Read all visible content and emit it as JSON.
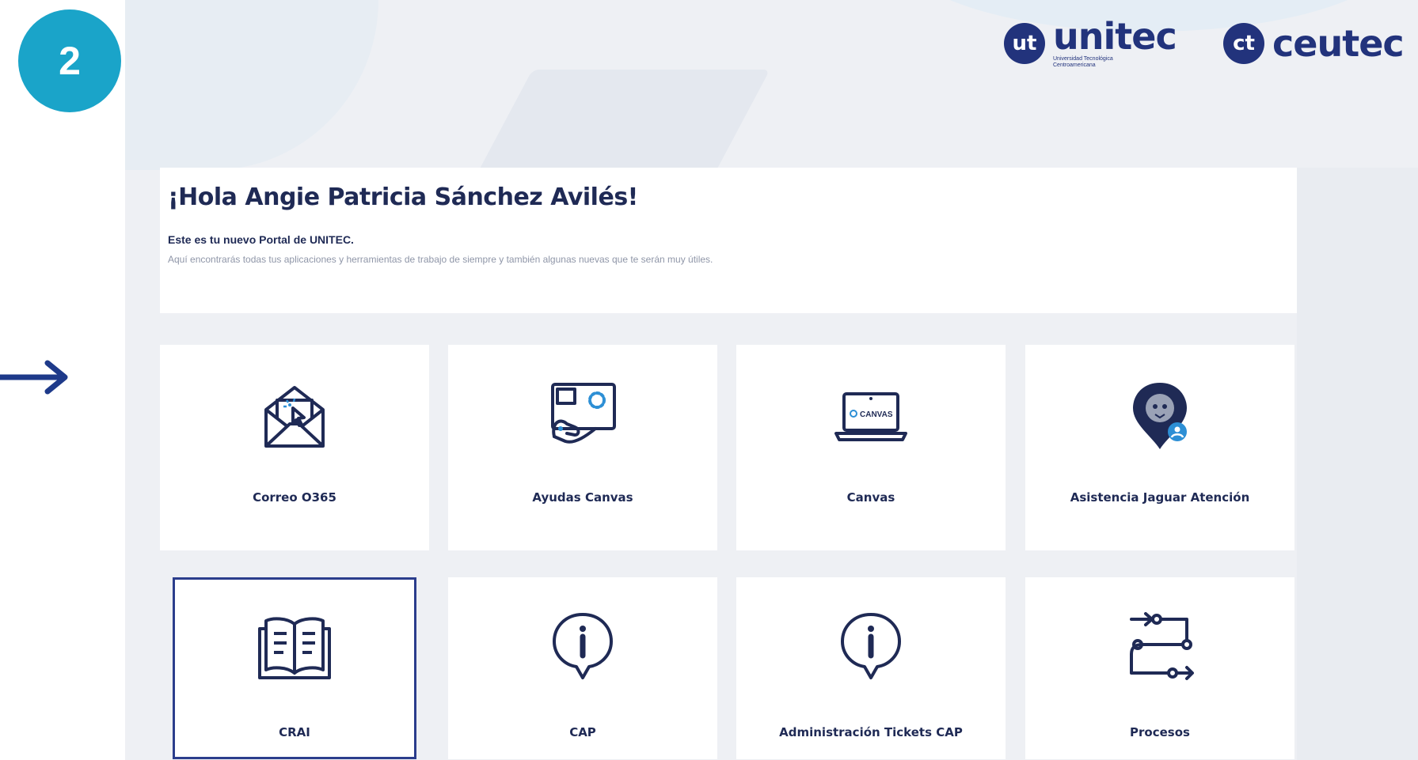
{
  "step": {
    "number": "2"
  },
  "logos": {
    "unitec": {
      "mark": "ut",
      "name": "unitec",
      "subtitle": "Universidad Tecnológica Centroamericana"
    },
    "ceutec": {
      "mark": "ct",
      "name": "ceutec"
    }
  },
  "welcome": {
    "greeting": "¡Hola Angie Patricia Sánchez Avilés!",
    "subtitle": "Este es tu nuevo Portal de UNITEC.",
    "description": "Aquí encontrarás todas tus aplicaciones y herramientas de trabajo de siempre y también algunas nuevas que te serán muy útiles."
  },
  "apps": [
    {
      "label": "Correo O365",
      "icon": "envelope-cursor-icon"
    },
    {
      "label": "Ayudas Canvas",
      "icon": "canvas-help-icon"
    },
    {
      "label": "Canvas",
      "icon": "laptop-canvas-icon"
    },
    {
      "label": "Asistencia Jaguar Atención",
      "icon": "jaguar-pin-icon"
    },
    {
      "label": "CRAI",
      "icon": "open-book-icon",
      "selected": true
    },
    {
      "label": "CAP",
      "icon": "info-bubble-icon"
    },
    {
      "label": "Administración Tickets CAP",
      "icon": "info-bubble-icon"
    },
    {
      "label": "Procesos",
      "icon": "process-flow-icon"
    }
  ],
  "canvas_screen_text": "CANVAS",
  "colors": {
    "accent": "#1aa4c9",
    "navy": "#22337c",
    "text": "#1f2a55",
    "muted": "#8f96a8",
    "page_bg": "#eef0f4",
    "selected_border": "#2b3d8c"
  }
}
